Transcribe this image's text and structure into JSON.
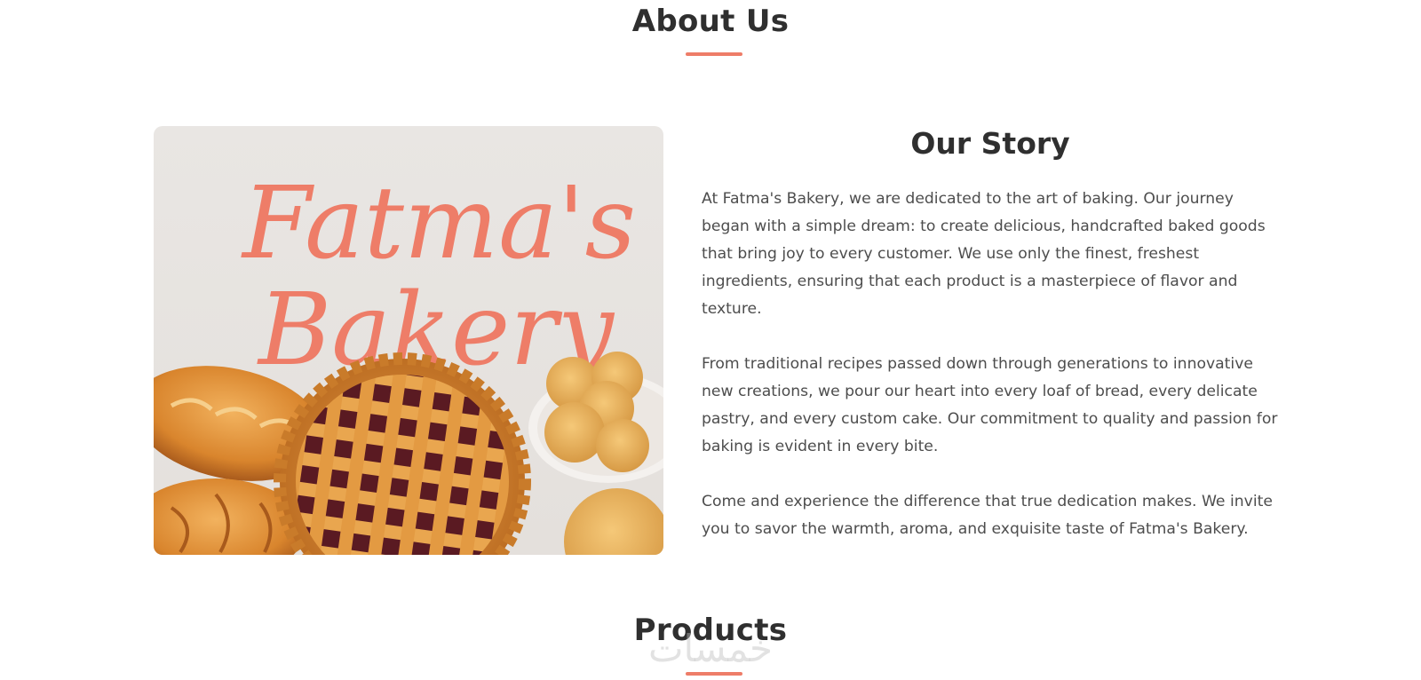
{
  "about": {
    "title": "About Us"
  },
  "hero_image": {
    "logo_text_line1": "Fatma's",
    "logo_text_line2": "Bakery",
    "accent_color": "#ee7d68"
  },
  "story": {
    "title": "Our Story",
    "paragraphs": [
      "At Fatma's Bakery, we are dedicated to the art of baking. Our journey began with a simple dream: to create delicious, handcrafted baked goods that bring joy to every customer. We use only the finest, freshest ingredients, ensuring that each product is a masterpiece of flavor and texture.",
      "From traditional recipes passed down through generations to innovative new creations, we pour our heart into every loaf of bread, every delicate pastry, and every custom cake. Our commitment to quality and passion for baking is evident in every bite.",
      "Come and experience the difference that true dedication makes. We invite you to savor the warmth, aroma, and exquisite taste of Fatma's Bakery."
    ]
  },
  "products": {
    "title": "Products"
  },
  "watermark": {
    "text": "خمسات"
  },
  "colors": {
    "accent": "#ee7d68",
    "heading": "#2f2f2f",
    "body_text": "#4d4d4d"
  }
}
